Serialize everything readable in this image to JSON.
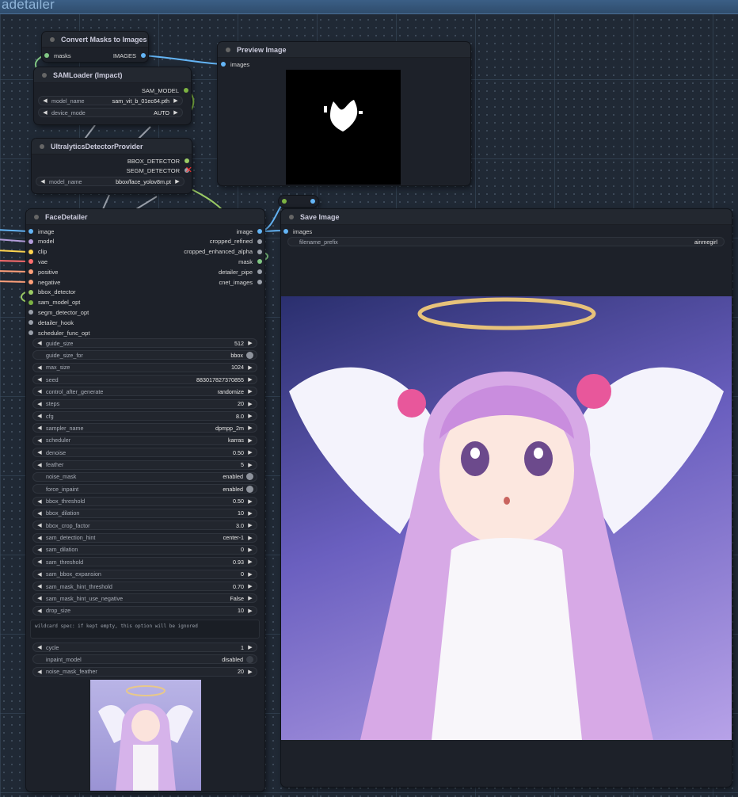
{
  "group": {
    "title": "adetailer"
  },
  "nodes": {
    "convert_masks": {
      "title": "Convert Masks to Images",
      "input": "masks",
      "output": "IMAGES"
    },
    "preview_image": {
      "title": "Preview Image",
      "input": "images"
    },
    "sam_loader": {
      "title": "SAMLoader (Impact)",
      "output": "SAM_MODEL",
      "widgets": [
        {
          "label": "model_name",
          "value": "sam_vit_b_01ec64.pth"
        },
        {
          "label": "device_mode",
          "value": "AUTO"
        }
      ]
    },
    "ultralytics": {
      "title": "UltralyticsDetectorProvider",
      "outputs": [
        "BBOX_DETECTOR",
        "SEGM_DETECTOR"
      ],
      "widget": {
        "label": "model_name",
        "value": "bbox/face_yolov8m.pt"
      }
    },
    "reroute": {},
    "save_image": {
      "title": "Save Image",
      "input": "images",
      "widget": {
        "label": "filename_prefix",
        "value": "ainmegirl"
      }
    },
    "face_detailer": {
      "title": "FaceDetailer",
      "inputs": [
        "image",
        "model",
        "clip",
        "vae",
        "positive",
        "negative",
        "bbox_detector",
        "sam_model_opt",
        "segm_detector_opt",
        "detailer_hook",
        "scheduler_func_opt"
      ],
      "outputs": [
        "image",
        "cropped_refined",
        "cropped_enhanced_alpha",
        "mask",
        "detailer_pipe",
        "cnet_images"
      ],
      "widgets": [
        {
          "label": "guide_size",
          "value": "512",
          "kind": "number"
        },
        {
          "label": "guide_size_for",
          "value": "bbox",
          "kind": "toggle"
        },
        {
          "label": "max_size",
          "value": "1024",
          "kind": "number"
        },
        {
          "label": "seed",
          "value": "883017827370855",
          "kind": "number"
        },
        {
          "label": "control_after_generate",
          "value": "randomize",
          "kind": "number"
        },
        {
          "label": "steps",
          "value": "20",
          "kind": "number"
        },
        {
          "label": "cfg",
          "value": "8.0",
          "kind": "number"
        },
        {
          "label": "sampler_name",
          "value": "dpmpp_2m",
          "kind": "number"
        },
        {
          "label": "scheduler",
          "value": "karras",
          "kind": "number"
        },
        {
          "label": "denoise",
          "value": "0.50",
          "kind": "number"
        },
        {
          "label": "feather",
          "value": "5",
          "kind": "number"
        },
        {
          "label": "noise_mask",
          "value": "enabled",
          "kind": "toggle"
        },
        {
          "label": "force_inpaint",
          "value": "enabled",
          "kind": "toggle"
        },
        {
          "label": "bbox_threshold",
          "value": "0.50",
          "kind": "number"
        },
        {
          "label": "bbox_dilation",
          "value": "10",
          "kind": "number"
        },
        {
          "label": "bbox_crop_factor",
          "value": "3.0",
          "kind": "number"
        },
        {
          "label": "sam_detection_hint",
          "value": "center-1",
          "kind": "number"
        },
        {
          "label": "sam_dilation",
          "value": "0",
          "kind": "number"
        },
        {
          "label": "sam_threshold",
          "value": "0.93",
          "kind": "number"
        },
        {
          "label": "sam_bbox_expansion",
          "value": "0",
          "kind": "number"
        },
        {
          "label": "sam_mask_hint_threshold",
          "value": "0.70",
          "kind": "number"
        },
        {
          "label": "sam_mask_hint_use_negative",
          "value": "False",
          "kind": "number"
        },
        {
          "label": "drop_size",
          "value": "10",
          "kind": "number"
        }
      ],
      "wildcard_placeholder": "wildcard spec: if kept empty, this option will be ignored",
      "widgets_after": [
        {
          "label": "cycle",
          "value": "1",
          "kind": "number"
        },
        {
          "label": "inpaint_model",
          "value": "disabled",
          "kind": "toggle-off"
        },
        {
          "label": "noise_mask_feather",
          "value": "20",
          "kind": "number"
        }
      ]
    }
  },
  "colors": {
    "image": "#64b5f6",
    "model": "#b39ddb",
    "clip": "#ffd54f",
    "vae": "#ff6e6e",
    "conditioning": "#ffa07a",
    "detector": "#9ccc65",
    "sam": "#7cb342",
    "mask": "#81c784",
    "generic": "#9aa0aa"
  }
}
